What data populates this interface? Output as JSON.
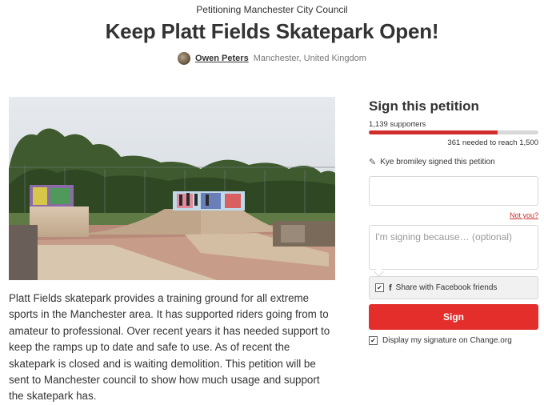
{
  "petition": {
    "target": "Petitioning Manchester City Council",
    "title": "Keep Platt Fields Skatepark Open!",
    "author_name": "Owen Peters",
    "author_location": "Manchester, United Kingdom",
    "description": "Platt Fields skatepark provides a training ground for all extreme sports in the Manchester area. It has supported riders going from to amateur to professional. Over recent years it has needed support to keep the ramps up to date and safe to use. As of recent the skatepark is closed and is waiting demolition. This petition will be sent to Manchester council to show how much usage and support the skatepark has."
  },
  "sidebar": {
    "title": "Sign this petition",
    "supporters": "1,139 supporters",
    "progress_fraction": 0.76,
    "needed": "361 needed to reach 1,500",
    "recent_signer": "Kye bromiley signed this petition",
    "name_value": "",
    "not_you": "Not you?",
    "reason_placeholder": "I'm signing because… (optional)",
    "share_facebook": "Share with Facebook friends",
    "share_checked": true,
    "sign_label": "Sign",
    "display_signature": "Display my signature on Change.org",
    "display_checked": true
  },
  "icons": {
    "signer": "pen-icon",
    "facebook": "facebook-icon"
  },
  "colors": {
    "accent": "#e42e2b",
    "progress_fill": "#d22d2d",
    "progress_track": "#d8d8d8"
  }
}
